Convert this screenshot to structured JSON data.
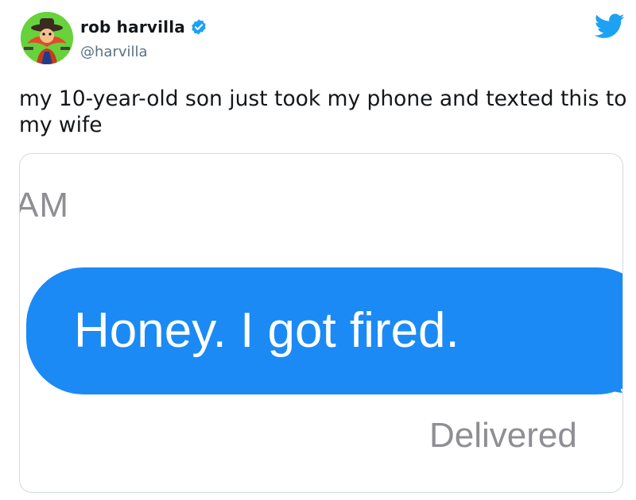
{
  "author": {
    "display_name": "rob harvilla",
    "handle": "@harvilla",
    "verified": true,
    "avatar_icon": "yosemite-sam-avatar"
  },
  "tweet": {
    "text": "my 10-year-old son just took my phone and texted this to my wife"
  },
  "media": {
    "time_label": "AM",
    "message": "Honey. I got fired.",
    "status": "Delivered"
  },
  "colors": {
    "twitter_blue": "#1da1f2",
    "imessage_blue": "#1b8af5",
    "gray_text": "#8e8e93",
    "avatar_bg": "#67d23c"
  },
  "icons": [
    "yosemite-sam-avatar",
    "verified-badge-icon",
    "twitter-bird-icon"
  ]
}
